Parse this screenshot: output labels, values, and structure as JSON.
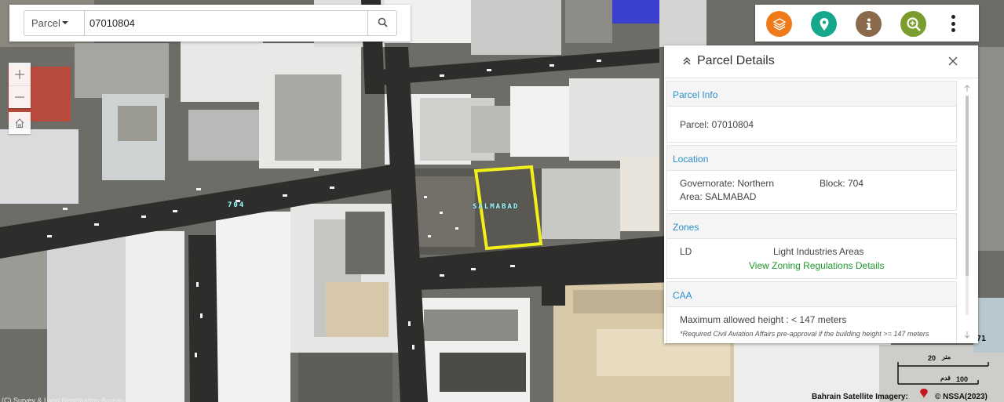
{
  "search": {
    "type_label": "Parcel",
    "value": "07010804"
  },
  "map": {
    "street_label": "704",
    "area_label": "SALMABAD",
    "cut_label": "71",
    "scale": {
      "metric": "20",
      "metric_unit": "متر",
      "imperial": "100",
      "imperial_unit": "قدم"
    },
    "credit_imagery": "Bahrain Satellite Imagery:",
    "credit_copyright": "© NSSA(2023)",
    "credit_left": "(C) Survey & Land Registration Bureau & Government Authority"
  },
  "toolbar": {
    "icons": [
      "layers-icon",
      "location-pin-icon",
      "info-icon",
      "zoom-search-icon",
      "more-vert-icon"
    ],
    "colors": {
      "layers": "#ef7a1a",
      "location": "#17a88c",
      "info": "#8a6a4a",
      "zoom": "#7a9d2e"
    }
  },
  "panel": {
    "title": "Parcel Details",
    "sections": {
      "parcel_info": {
        "title": "Parcel Info",
        "parcel": "Parcel: 07010804"
      },
      "location": {
        "title": "Location",
        "governorate": "Governorate: Northern",
        "block": "Block: 704",
        "area": "Area: SALMABAD"
      },
      "zones": {
        "title": "Zones",
        "code": "LD",
        "name": "Light Industries Areas",
        "link": "View Zoning Regulations Details"
      },
      "caa": {
        "title": "CAA",
        "height": "Maximum allowed height : < 147 meters",
        "note": "*Required Civil Aviation Affairs pre-approval if the building height >= 147 meters"
      }
    }
  },
  "colors": {
    "accent_blue": "#2b8fc9",
    "link_green": "#1e9a2e",
    "parcel_outline": "#f2ef1a"
  }
}
